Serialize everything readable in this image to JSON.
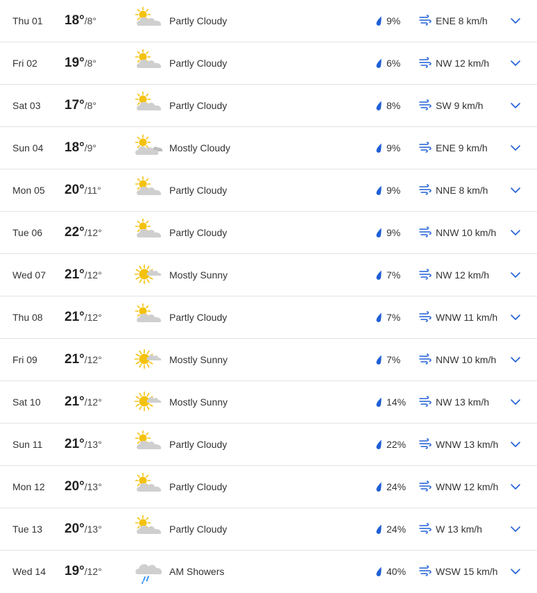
{
  "colors": {
    "accent": "#1f5fd6",
    "sun": "#f4c20d",
    "cloud": "#cfcfcf",
    "divider": "#e3e3e3"
  },
  "forecast": [
    {
      "day": "Thu 01",
      "high": "18°",
      "low": "8°",
      "icon": "partly-cloudy",
      "condition": "Partly Cloudy",
      "precip": "9%",
      "wind": "ENE 8 km/h"
    },
    {
      "day": "Fri 02",
      "high": "19°",
      "low": "8°",
      "icon": "partly-cloudy",
      "condition": "Partly Cloudy",
      "precip": "6%",
      "wind": "NW 12 km/h"
    },
    {
      "day": "Sat 03",
      "high": "17°",
      "low": "8°",
      "icon": "partly-cloudy",
      "condition": "Partly Cloudy",
      "precip": "8%",
      "wind": "SW 9 km/h"
    },
    {
      "day": "Sun 04",
      "high": "18°",
      "low": "9°",
      "icon": "mostly-cloudy",
      "condition": "Mostly Cloudy",
      "precip": "9%",
      "wind": "ENE 9 km/h"
    },
    {
      "day": "Mon 05",
      "high": "20°",
      "low": "11°",
      "icon": "partly-cloudy",
      "condition": "Partly Cloudy",
      "precip": "9%",
      "wind": "NNE 8 km/h"
    },
    {
      "day": "Tue 06",
      "high": "22°",
      "low": "12°",
      "icon": "partly-cloudy",
      "condition": "Partly Cloudy",
      "precip": "9%",
      "wind": "NNW 10 km/h"
    },
    {
      "day": "Wed 07",
      "high": "21°",
      "low": "12°",
      "icon": "mostly-sunny",
      "condition": "Mostly Sunny",
      "precip": "7%",
      "wind": "NW 12 km/h"
    },
    {
      "day": "Thu 08",
      "high": "21°",
      "low": "12°",
      "icon": "partly-cloudy",
      "condition": "Partly Cloudy",
      "precip": "7%",
      "wind": "WNW 11 km/h"
    },
    {
      "day": "Fri 09",
      "high": "21°",
      "low": "12°",
      "icon": "mostly-sunny",
      "condition": "Mostly Sunny",
      "precip": "7%",
      "wind": "NNW 10 km/h"
    },
    {
      "day": "Sat 10",
      "high": "21°",
      "low": "12°",
      "icon": "mostly-sunny",
      "condition": "Mostly Sunny",
      "precip": "14%",
      "wind": "NW 13 km/h"
    },
    {
      "day": "Sun 11",
      "high": "21°",
      "low": "13°",
      "icon": "partly-cloudy",
      "condition": "Partly Cloudy",
      "precip": "22%",
      "wind": "WNW 13 km/h"
    },
    {
      "day": "Mon 12",
      "high": "20°",
      "low": "13°",
      "icon": "partly-cloudy",
      "condition": "Partly Cloudy",
      "precip": "24%",
      "wind": "WNW 12 km/h"
    },
    {
      "day": "Tue 13",
      "high": "20°",
      "low": "13°",
      "icon": "partly-cloudy",
      "condition": "Partly Cloudy",
      "precip": "24%",
      "wind": "W 13 km/h"
    },
    {
      "day": "Wed 14",
      "high": "19°",
      "low": "12°",
      "icon": "showers",
      "condition": "AM Showers",
      "precip": "40%",
      "wind": "WSW 15 km/h"
    }
  ]
}
